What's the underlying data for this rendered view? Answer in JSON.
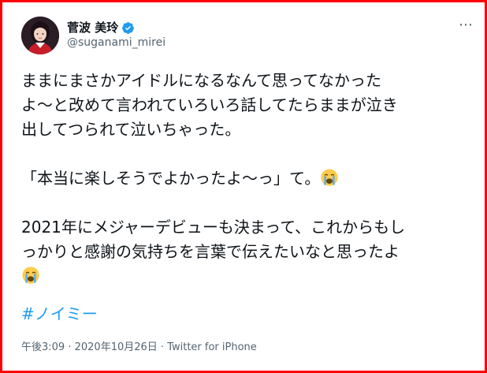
{
  "user": {
    "display_name": "菅波 美玲",
    "handle": "@suganami_mirei",
    "avatar": "avatar-photo",
    "verified_icon": "verified-badge-icon"
  },
  "menu": {
    "more_label": "⋯"
  },
  "tweet": {
    "lines": [
      "ままにまさかアイドルになるなんて思ってなかった",
      "よ～と改めて言われていろいろ話してたらままが泣き",
      "出してつられて泣いちゃった。",
      "「本当に楽しそうでよかったよ～っ」て。",
      "2021年にメジャーデビューも決まって、これからもし",
      "っかりと感謝の気持ちを言葉で伝えたいなと思ったよ"
    ],
    "emoji": "loudly-crying-face",
    "hashtag": "#ノイミー"
  },
  "meta": {
    "time": "午後3:09",
    "sep1": " · ",
    "date": "2020年10月26日",
    "sep2": " · ",
    "app": "Twitter for iPhone"
  },
  "colors": {
    "border": "#ff0000",
    "link": "#1d9bf0",
    "verified": "#1d9bf0",
    "secondary_text": "#536471"
  }
}
